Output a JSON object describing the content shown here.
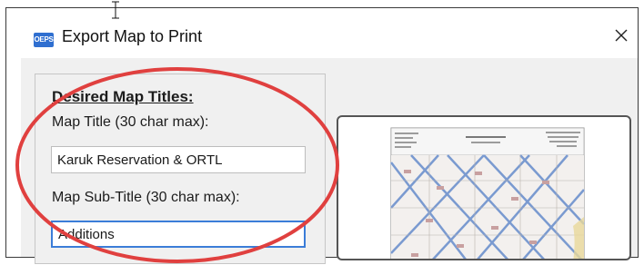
{
  "window": {
    "app_icon_label": "OEPS",
    "title": "Export Map to Print"
  },
  "titles_section": {
    "heading": "Desired Map Titles:",
    "map_title_label": "Map Title (30 char max):",
    "map_title_value": "Karuk Reservation & ORTL",
    "subtitle_label": "Map Sub-Title (30 char max):",
    "subtitle_value": "Additions"
  },
  "icons": {
    "close": "close-icon",
    "app": "app-icon",
    "cursor": "text-cursor-icon"
  },
  "colors": {
    "annotation_circle": "#e0403f",
    "focus_border": "#3b7dd8",
    "app_icon_bg": "#2f6fd0"
  }
}
